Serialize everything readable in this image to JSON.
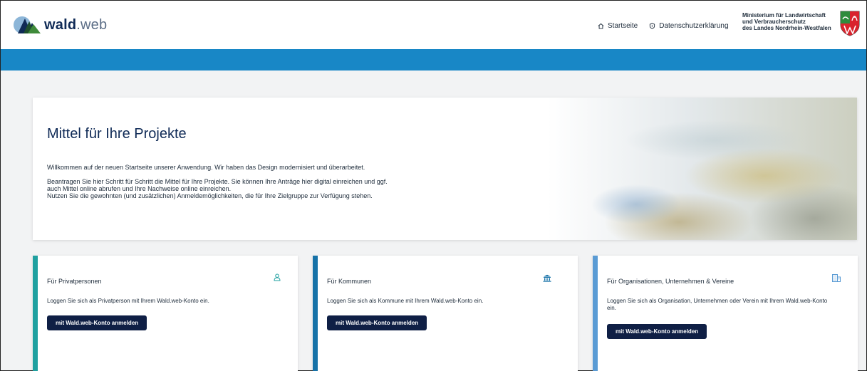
{
  "header": {
    "logo_bold": "wald",
    "logo_light": ".web",
    "nav": [
      {
        "label": "Startseite",
        "icon": "home-icon"
      },
      {
        "label": "Datenschutzerklärung",
        "icon": "shield-icon"
      }
    ],
    "ministry_lines": [
      "Ministerium für Landwirtschaft",
      "und Verbraucherschutz",
      "des Landes Nordrhein-Westfalen"
    ]
  },
  "hero": {
    "title": "Mittel für Ihre Projekte",
    "p1": "Willkommen auf der neuen Startseite unserer Anwendung. Wir haben das Design modernisiert und überarbeitet.",
    "p2_line1": "Beantragen Sie hier Schritt für Schritt die Mittel für Ihre Projekte. Sie können Ihre Anträge hier digital einreichen und ggf.",
    "p2_line2": "auch Mittel online abrufen und Ihre Nachweise online einreichen.",
    "p2_line3": "Nutzen Sie die gewohnten (und zusätzlichen) Anmeldemöglichkeiten, die für Ihre Zielgruppe zur Verfügung stehen."
  },
  "cards": [
    {
      "title": "Für Privatpersonen",
      "icon": "person-icon",
      "desc": "Loggen Sie sich als Privatperson mit Ihrem Wald.web-Konto ein.",
      "button": "mit Wald.web-Konto anmelden",
      "accent": "#1fa0a0"
    },
    {
      "title": "Für Kommunen",
      "icon": "municipal-building-icon",
      "desc": "Loggen Sie sich als Kommune mit Ihrem Wald.web-Konto ein.",
      "button": "mit Wald.web-Konto anmelden",
      "accent": "#1672a8"
    },
    {
      "title": "Für Organisationen, Unternehmen & Vereine",
      "icon": "office-building-icon",
      "desc": "Loggen Sie sich als Organisation, Unternehmen oder Verein mit Ihrem Wald.web-Konto ein.",
      "button": "mit Wald.web-Konto anmelden",
      "accent": "#5a9bd4"
    }
  ],
  "colors": {
    "brand_blue": "#1887c6",
    "button_dark": "#0f1f45",
    "title_navy": "#0f2a56"
  }
}
